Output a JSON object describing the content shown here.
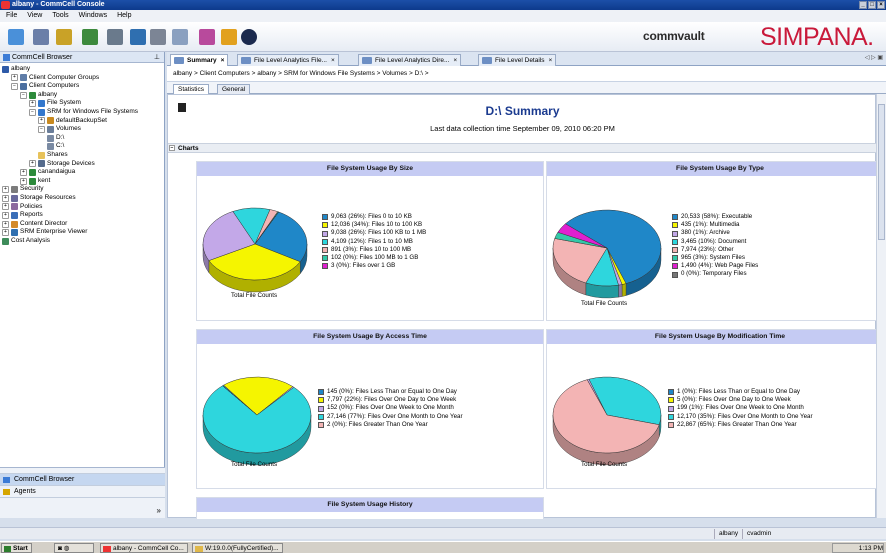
{
  "window": {
    "title": "albany - CommCell Console"
  },
  "menu": [
    "File",
    "View",
    "Tools",
    "Windows",
    "Help"
  ],
  "branding": {
    "vendor": "commvault",
    "product": "SIMPANA."
  },
  "left_pane": {
    "title": "CommCell Browser",
    "tree": [
      {
        "label": "albany",
        "depth": 0,
        "icon": "server-icon"
      },
      {
        "label": "Client Computer Groups",
        "depth": 1,
        "icon": "group-icon"
      },
      {
        "label": "Client Computers",
        "depth": 1,
        "icon": "clients-icon"
      },
      {
        "label": "albany",
        "depth": 2,
        "icon": "client-icon"
      },
      {
        "label": "File System",
        "depth": 3,
        "icon": "filesystem-icon"
      },
      {
        "label": "SRM for Windows File Systems",
        "depth": 3,
        "icon": "srm-icon"
      },
      {
        "label": "defaultBackupSet",
        "depth": 4,
        "icon": "backupset-icon"
      },
      {
        "label": "Volumes",
        "depth": 4,
        "icon": "volumes-icon"
      },
      {
        "label": "D:\\",
        "depth": 5,
        "icon": "drive-icon"
      },
      {
        "label": "C:\\",
        "depth": 5,
        "icon": "drive-icon"
      },
      {
        "label": "Shares",
        "depth": 4,
        "icon": "folder-icon"
      },
      {
        "label": "Storage Devices",
        "depth": 3,
        "icon": "storage-icon"
      },
      {
        "label": "canandaigua",
        "depth": 2,
        "icon": "client-icon"
      },
      {
        "label": "kent",
        "depth": 2,
        "icon": "client-icon"
      },
      {
        "label": "Security",
        "depth": 0,
        "icon": "security-icon"
      },
      {
        "label": "Storage Resources",
        "depth": 0,
        "icon": "storage-resources-icon"
      },
      {
        "label": "Policies",
        "depth": 0,
        "icon": "policies-icon"
      },
      {
        "label": "Reports",
        "depth": 0,
        "icon": "reports-icon"
      },
      {
        "label": "Content Director",
        "depth": 0,
        "icon": "content-director-icon"
      },
      {
        "label": "SRM Enterprise Viewer",
        "depth": 0,
        "icon": "srm-viewer-icon"
      },
      {
        "label": "Cost Analysis",
        "depth": 0,
        "icon": "cost-analysis-icon"
      }
    ],
    "bottom_buttons": [
      "CommCell Browser",
      "Agents"
    ]
  },
  "tabs": [
    {
      "label": "Summary",
      "active": true
    },
    {
      "label": "File Level Analytics File...",
      "active": false
    },
    {
      "label": "File Level Analytics Dire...",
      "active": false
    },
    {
      "label": "File Level Details",
      "active": false
    }
  ],
  "breadcrumb": [
    "albany",
    "Client Computers",
    "albany",
    "SRM for Windows File Systems",
    "Volumes",
    "D:\\"
  ],
  "subtabs": [
    {
      "label": "Statistics",
      "active": true
    },
    {
      "label": "General",
      "active": false
    }
  ],
  "summary": {
    "title": "D:\\ Summary",
    "subtitle": "Last data collection time September 09, 2010 06:20 PM",
    "section": "Charts"
  },
  "chart_data": [
    {
      "type": "pie",
      "title": "File System Usage By Size",
      "caption": "Total File Counts",
      "slices": [
        {
          "label": "9,063 (26%): Files 0 to 10 KB",
          "value": 9063,
          "color": "#1f87c8"
        },
        {
          "label": "12,036 (34%): Files 10 to 100 KB",
          "value": 12036,
          "color": "#f5f500"
        },
        {
          "label": "9,038 (26%): Files 100 KB to 1 MB",
          "value": 9038,
          "color": "#c3a8e8"
        },
        {
          "label": "4,109 (12%): Files 1 to 10 MB",
          "value": 4109,
          "color": "#2ed6dd"
        },
        {
          "label": "891 (3%): Files 10 to 100 MB",
          "value": 891,
          "color": "#f3b4b4"
        },
        {
          "label": "102 (0%): Files 100 MB to 1 GB",
          "value": 102,
          "color": "#33c8a8"
        },
        {
          "label": "3 (0%): Files over 1 GB",
          "value": 3,
          "color": "#e020d0"
        }
      ]
    },
    {
      "type": "pie",
      "title": "File System Usage By Type",
      "caption": "Total File Counts",
      "slices": [
        {
          "label": "20,533 (58%): Executable",
          "value": 20533,
          "color": "#1f87c8"
        },
        {
          "label": "435 (1%): Multimedia",
          "value": 435,
          "color": "#f5f500"
        },
        {
          "label": "380 (1%): Archive",
          "value": 380,
          "color": "#c3a8e8"
        },
        {
          "label": "3,465 (10%): Document",
          "value": 3465,
          "color": "#2ed6dd"
        },
        {
          "label": "7,974 (23%): Other",
          "value": 7974,
          "color": "#f3b4b4"
        },
        {
          "label": "965 (3%): System Files",
          "value": 965,
          "color": "#33c8a8"
        },
        {
          "label": "1,490 (4%): Web Page Files",
          "value": 1490,
          "color": "#e020d0"
        },
        {
          "label": "0 (0%): Temporary Files",
          "value": 0,
          "color": "#777777"
        }
      ]
    },
    {
      "type": "pie",
      "title": "File System Usage By Access Time",
      "caption": "Total File Counts",
      "slices": [
        {
          "label": "145 (0%): Files Less Than or Equal to One Day",
          "value": 145,
          "color": "#1f87c8"
        },
        {
          "label": "7,797 (22%): Files Over One Day to One Week",
          "value": 7797,
          "color": "#f5f500"
        },
        {
          "label": "152 (0%): Files Over One Week to One Month",
          "value": 152,
          "color": "#c3a8e8"
        },
        {
          "label": "27,146 (77%): Files Over One Month to One Year",
          "value": 27146,
          "color": "#2ed6dd"
        },
        {
          "label": "2 (0%): Files Greater Than One Year",
          "value": 2,
          "color": "#f3b4b4"
        }
      ]
    },
    {
      "type": "pie",
      "title": "File System Usage By Modification Time",
      "caption": "Total File Counts",
      "slices": [
        {
          "label": "1 (0%): Files Less Than or Equal to One Day",
          "value": 1,
          "color": "#1f87c8"
        },
        {
          "label": "5 (0%): Files Over One Day to One Week",
          "value": 5,
          "color": "#f5f500"
        },
        {
          "label": "199 (1%): Files Over One Week to One Month",
          "value": 199,
          "color": "#c3a8e8"
        },
        {
          "label": "12,170 (35%): Files Over One Month to One Year",
          "value": 12170,
          "color": "#2ed6dd"
        },
        {
          "label": "22,867 (65%): Files Greater Than One Year",
          "value": 22867,
          "color": "#f3b4b4"
        }
      ]
    }
  ],
  "history_panel": {
    "title": "File System Usage History"
  },
  "statusbar": {
    "server": "albany",
    "user": "cvadmin"
  },
  "taskbar": {
    "start": "Start",
    "items": [
      "albany - CommCell Co...",
      "W:19.0.0(FullyCertified)..."
    ],
    "clock": "1:13 PM"
  }
}
